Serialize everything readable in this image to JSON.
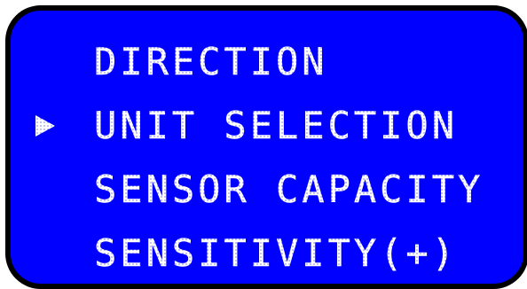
{
  "screen": {
    "background_color": "#0000ff",
    "text_color": "#ffffff",
    "border_color": "#000000"
  },
  "menu": {
    "cursor_icon": "right-triangle-cursor",
    "selected_index": 1,
    "items": [
      {
        "label": "DIRECTION"
      },
      {
        "label": "UNIT SELECTION"
      },
      {
        "label": "SENSOR CAPACITY"
      },
      {
        "label": "SENSITIVITY(+)"
      }
    ]
  }
}
